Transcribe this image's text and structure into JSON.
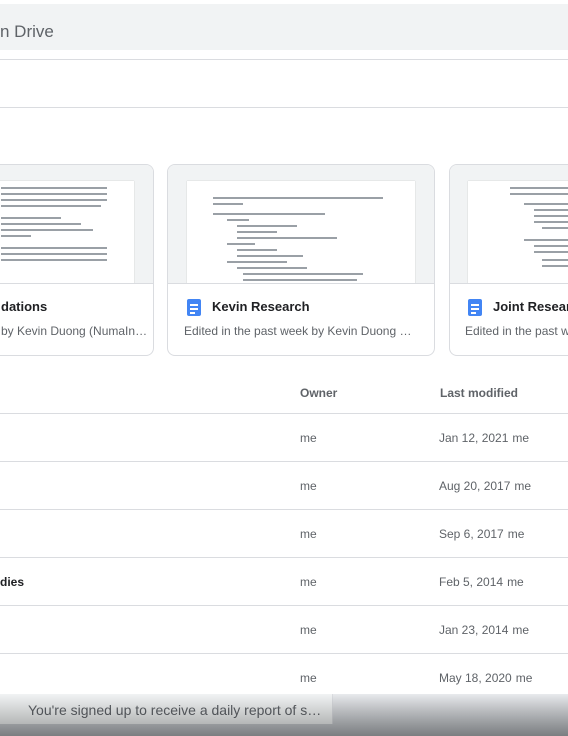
{
  "search": {
    "placeholder_visible": "n Drive"
  },
  "suggested": [
    {
      "title": "dations",
      "subtitle": "by Kevin Duong (NumaIn…"
    },
    {
      "title": "Kevin Research",
      "subtitle": "Edited in the past week by Kevin Duong (…"
    },
    {
      "title": "Joint Researc",
      "subtitle": "Edited in the past w"
    }
  ],
  "table": {
    "headers": {
      "owner": "Owner",
      "last_modified": "Last modified"
    },
    "rows": [
      {
        "name": "",
        "owner": "me",
        "date": "Jan 12, 2021",
        "by": "me"
      },
      {
        "name": "",
        "owner": "me",
        "date": "Aug 20, 2017",
        "by": "me"
      },
      {
        "name": "",
        "owner": "me",
        "date": "Sep 6, 2017",
        "by": "me"
      },
      {
        "name": "dies",
        "owner": "me",
        "date": "Feb 5, 2014",
        "by": "me"
      },
      {
        "name": "",
        "owner": "me",
        "date": "Jan 23, 2014",
        "by": "me"
      },
      {
        "name": "",
        "owner": "me",
        "date": "May 18, 2020",
        "by": "me"
      }
    ]
  },
  "toast": {
    "text": "You're signed up to receive a daily report of s…"
  }
}
